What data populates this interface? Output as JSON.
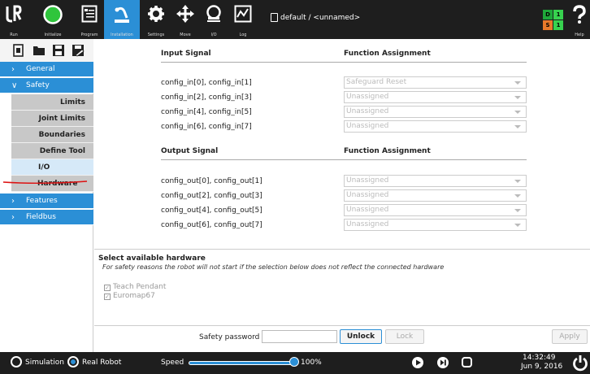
{
  "topbar": {
    "buttons": [
      {
        "label": "Run",
        "icon": "ur-logo-icon"
      },
      {
        "label": "Initialize",
        "icon": "power-circle-icon"
      },
      {
        "label": "Program",
        "icon": "program-icon"
      },
      {
        "label": "Installation",
        "icon": "installation-icon"
      },
      {
        "label": "Settings",
        "icon": "gear-icon"
      },
      {
        "label": "Move",
        "icon": "move-arrows-icon"
      },
      {
        "label": "I/O",
        "icon": "io-icon"
      },
      {
        "label": "Log",
        "icon": "log-chart-icon"
      },
      {
        "label": "Help",
        "icon": "help-icon"
      }
    ],
    "file_title": "default / <unnamed>",
    "indicators": [
      {
        "text": "D",
        "color": "#1fa83a"
      },
      {
        "text": "1",
        "color": "#37d24f"
      },
      {
        "text": "S",
        "color": "#e8792a"
      },
      {
        "text": "1",
        "color": "#37d24f"
      }
    ]
  },
  "sidebar": {
    "top_items": [
      {
        "label": "General",
        "chevron": "›"
      },
      {
        "label": "Safety",
        "chevron": "∨"
      }
    ],
    "safety_items": [
      {
        "label": "Limits"
      },
      {
        "label": "Joint Limits"
      },
      {
        "label": "Boundaries"
      },
      {
        "label": "Define Tool"
      },
      {
        "label": "I/O"
      },
      {
        "label": "Hardware"
      }
    ],
    "bottom_items": [
      {
        "label": "Features",
        "chevron": "›"
      },
      {
        "label": "Fieldbus",
        "chevron": "›"
      }
    ]
  },
  "main": {
    "input_header": "Input Signal",
    "output_header": "Output Signal",
    "func_header": "Function Assignment",
    "inputs": [
      {
        "signal": "config_in[0], config_in[1]",
        "value": "Safeguard Reset"
      },
      {
        "signal": "config_in[2], config_in[3]",
        "value": "Unassigned"
      },
      {
        "signal": "config_in[4], config_in[5]",
        "value": "Unassigned"
      },
      {
        "signal": "config_in[6], config_in[7]",
        "value": "Unassigned"
      }
    ],
    "outputs": [
      {
        "signal": "config_out[0], config_out[1]",
        "value": "Unassigned"
      },
      {
        "signal": "config_out[2], config_out[3]",
        "value": "Unassigned"
      },
      {
        "signal": "config_out[4], config_out[5]",
        "value": "Unassigned"
      },
      {
        "signal": "config_out[6], config_out[7]",
        "value": "Unassigned"
      }
    ],
    "hardware": {
      "title": "Select available hardware",
      "note": "For safety reasons the robot will not start if the selection below does not reflect the connected hardware",
      "options": [
        {
          "label": "Teach Pendant",
          "checked": true
        },
        {
          "label": "Euromap67",
          "checked": true
        }
      ]
    },
    "password": {
      "label": "Safety password",
      "value": "",
      "unlock": "Unlock",
      "lock": "Lock",
      "apply": "Apply"
    }
  },
  "bottombar": {
    "simulation": "Simulation",
    "real_robot": "Real Robot",
    "mode_selected": "Real Robot",
    "speed_label": "Speed",
    "speed_value": "100%",
    "speed_fraction": 1.0,
    "time": "14:32:49",
    "date": "Jun 9, 2016"
  }
}
